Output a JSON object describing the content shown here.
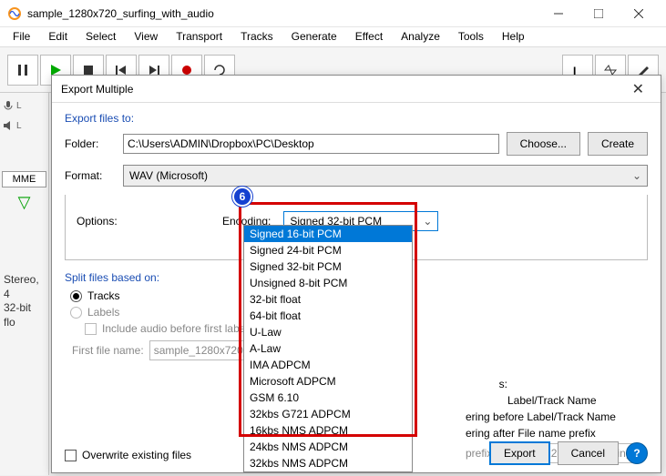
{
  "app": {
    "title": "sample_1280x720_surfing_with_audio"
  },
  "menu": [
    "File",
    "Edit",
    "Select",
    "View",
    "Transport",
    "Tracks",
    "Generate",
    "Effect",
    "Analyze",
    "Tools",
    "Help"
  ],
  "left": {
    "mme": "MME",
    "stereo1": "Stereo, 4",
    "stereo2": "32-bit flo"
  },
  "dialog": {
    "title": "Export Multiple",
    "export_to": "Export files to:",
    "folder_label": "Folder:",
    "folder_value": "C:\\Users\\ADMIN\\Dropbox\\PC\\Desktop",
    "choose": "Choose...",
    "create": "Create",
    "format_label": "Format:",
    "format_value": "WAV (Microsoft)",
    "options_label": "Options:",
    "encoding_label": "Encoding:",
    "encoding_value": "Signed 32-bit PCM",
    "step": "6",
    "dropdown": [
      "Signed 16-bit PCM",
      "Signed 24-bit PCM",
      "Signed 32-bit PCM",
      "Unsigned 8-bit PCM",
      "32-bit float",
      "64-bit float",
      "U-Law",
      "A-Law",
      "IMA ADPCM",
      "Microsoft ADPCM",
      "GSM 6.10",
      "32kbs G721 ADPCM",
      "16kbs NMS ADPCM",
      "24kbs NMS ADPCM",
      "32kbs NMS ADPCM"
    ],
    "split_label": "Split files based on:",
    "tracks": "Tracks",
    "labels_opt": "Labels",
    "include_audio": "Include audio before first label",
    "first_file": "First file name:",
    "first_file_val": "sample_1280x720_su",
    "right_frag1": "s:",
    "right_frag2": "Label/Track Name",
    "right_frag3": "ering before Label/Track Name",
    "right_frag4": "ering after File name prefix",
    "prefix_label": "prefix:",
    "prefix_val": "sample_1280x720_surfing_with_audio",
    "overwrite": "Overwrite existing files",
    "export": "Export",
    "cancel": "Cancel"
  }
}
